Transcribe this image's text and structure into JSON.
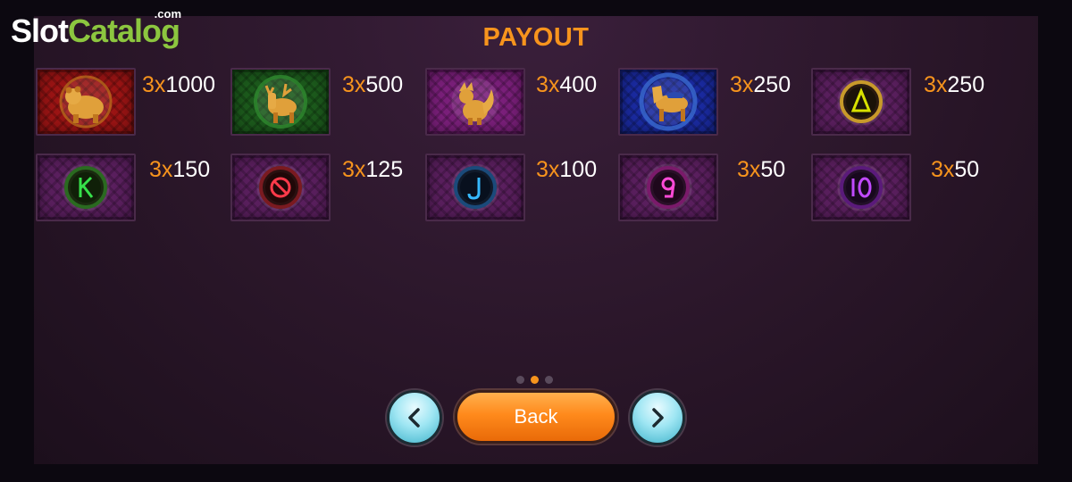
{
  "logo": {
    "brand_first": "Slot",
    "brand_second": "Catalog",
    "suffix": ".com"
  },
  "title": "PAYOUT",
  "symbols": [
    {
      "name": "bear",
      "icon": "bear-icon",
      "multiplier": "3x",
      "payout": "1000",
      "bg": "#9b1414",
      "accent": "#e0a03a"
    },
    {
      "name": "deer",
      "icon": "deer-icon",
      "multiplier": "3x",
      "payout": "500",
      "bg": "#1c5a1c",
      "accent": "#e0a03a"
    },
    {
      "name": "fox",
      "icon": "fox-icon",
      "multiplier": "3x",
      "payout": "400",
      "bg": "#7a1f7a",
      "accent": "#e0a03a"
    },
    {
      "name": "horse",
      "icon": "horse-icon",
      "multiplier": "3x",
      "payout": "250",
      "bg": "#1a2aa0",
      "accent": "#e0a03a"
    },
    {
      "name": "A",
      "icon": "a-glyph-icon",
      "multiplier": "3x",
      "payout": "250",
      "bg": "#5a1f5e",
      "accent": "#d8e000"
    },
    {
      "name": "K",
      "icon": "k-glyph-icon",
      "multiplier": "3x",
      "payout": "150",
      "bg": "#5a1f5e",
      "accent": "#36e04a"
    },
    {
      "name": "Q",
      "icon": "q-glyph-icon",
      "multiplier": "3x",
      "payout": "125",
      "bg": "#5a1f5e",
      "accent": "#ff3a4a"
    },
    {
      "name": "J",
      "icon": "j-glyph-icon",
      "multiplier": "3x",
      "payout": "100",
      "bg": "#5a1f5e",
      "accent": "#36b8ff"
    },
    {
      "name": "9",
      "icon": "nine-glyph-icon",
      "multiplier": "3x",
      "payout": "50",
      "bg": "#5a1f5e",
      "accent": "#ff4ad8"
    },
    {
      "name": "10",
      "icon": "ten-glyph-icon",
      "multiplier": "3x",
      "payout": "50",
      "bg": "#5a1f5e",
      "accent": "#c04aff"
    }
  ],
  "pagination": {
    "total": 3,
    "active": 2
  },
  "nav": {
    "back_label": "Back",
    "prev_icon": "chevron-left-icon",
    "next_icon": "chevron-right-icon"
  },
  "colors": {
    "accent": "#f7941d",
    "panel": "#2a1629",
    "button": "#ff8a1c",
    "nav_button": "#9fe6f3"
  }
}
